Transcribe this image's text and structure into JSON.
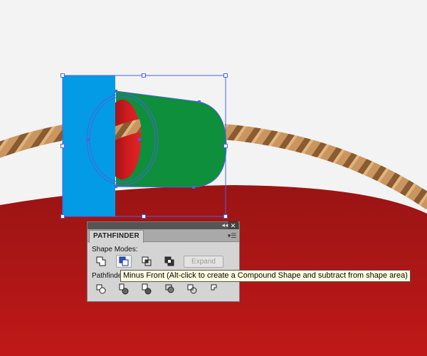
{
  "colors": {
    "background": "#f3f3f3",
    "plate_red": "#b51616",
    "rope_light": "#c99660",
    "rope_dark": "#8a5a30",
    "blue_rect": "#039be5",
    "green_shape": "#0d8f3b",
    "red_ellipse": "#cc1a1f",
    "selection": "#4a63e0"
  },
  "panel": {
    "title": "PATHFINDER",
    "collapse_icon": "double-left-arrow-icon",
    "close_icon": "close-icon",
    "menu_icon": "panel-menu-icon",
    "shape_modes_label": "Shape Modes:",
    "shape_modes": [
      {
        "name": "unite",
        "icon": "unite-icon"
      },
      {
        "name": "minus-front",
        "icon": "minus-front-icon",
        "active": true
      },
      {
        "name": "intersect",
        "icon": "intersect-icon"
      },
      {
        "name": "exclude",
        "icon": "exclude-icon"
      }
    ],
    "expand_label": "Expand",
    "pathfinders_label": "Pathfinders:",
    "pathfinders": [
      {
        "name": "divide",
        "icon": "divide-icon"
      },
      {
        "name": "trim",
        "icon": "trim-icon"
      },
      {
        "name": "merge",
        "icon": "merge-icon"
      },
      {
        "name": "crop",
        "icon": "crop-icon"
      },
      {
        "name": "outline",
        "icon": "outline-icon"
      },
      {
        "name": "minus-back",
        "icon": "minus-back-icon"
      }
    ]
  },
  "tooltip": {
    "text": "Minus Front (Alt-click to create a Compound Shape and subtract from shape area)"
  }
}
